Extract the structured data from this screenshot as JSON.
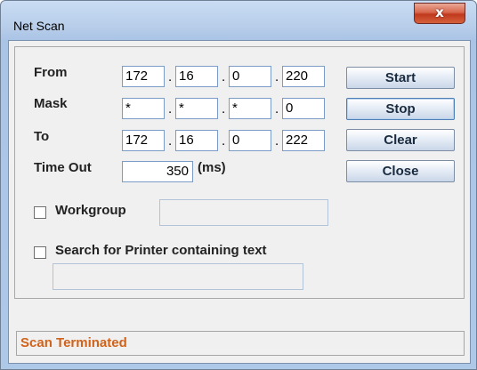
{
  "window": {
    "title": "Net Scan",
    "close_glyph": "x"
  },
  "form": {
    "from_label": "From",
    "mask_label": "Mask",
    "to_label": "To",
    "timeout_label": "Time Out",
    "timeout_value": "350",
    "timeout_unit": "(ms)",
    "from": [
      "172",
      "16",
      "0",
      "220"
    ],
    "mask": [
      "*",
      "*",
      "*",
      "0"
    ],
    "to": [
      "172",
      "16",
      "0",
      "222"
    ],
    "separator": "."
  },
  "buttons": {
    "start": "Start",
    "stop": "Stop",
    "clear": "Clear",
    "close": "Close"
  },
  "workgroup": {
    "label": "Workgroup",
    "checked": false,
    "value": ""
  },
  "printer_search": {
    "label": "Search for Printer containing text",
    "checked": false,
    "value": ""
  },
  "status": {
    "text": "Scan Terminated",
    "color": "#d0621a"
  }
}
